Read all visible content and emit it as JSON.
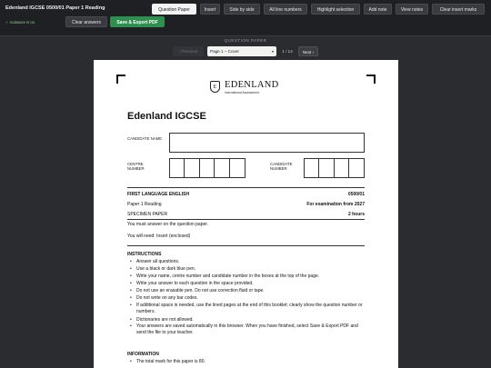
{
  "app": {
    "title": "Edenland IGCSE 0500/01 Paper 1 Reading",
    "autosave": "✓ Autosave is on"
  },
  "toolbar": {
    "question_paper": "Question Paper",
    "insert": "Insert",
    "side_by_side": "Side by side",
    "line_numbers": "All line numbers",
    "highlight": "Highlight selection",
    "add_note": "Add note",
    "view_notes": "View notes",
    "clear_marks": "Clear insert marks",
    "clear_answers": "Clear answers",
    "save_export": "Save & Export PDF"
  },
  "pager": {
    "section_label": "QUESTION PAPER",
    "prev": "‹ Previous",
    "selected": "Page 1 – Cover",
    "count": "1 / 14",
    "next": "Next ›"
  },
  "paper": {
    "logo_mark": "E",
    "logo_name": "EDENLAND",
    "logo_sub": "International Assessment",
    "title": "Edenland IGCSE",
    "candidate_name_label": "CANDIDATE NAME",
    "centre_number_label": "CENTRE NUMBER",
    "candidate_number_label": "CANDIDATE NUMBER",
    "subject": "FIRST LANGUAGE ENGLISH",
    "code": "0500/01",
    "paper_name": "Paper 1 Reading",
    "exam_from": "For examination from 2027",
    "specimen": "SPECIMEN PAPER",
    "duration": "2 hours",
    "answer_on": "You must answer on the question paper.",
    "you_will_need": "You will need:   Insert (enclosed)",
    "instructions_heading": "INSTRUCTIONS",
    "instructions": [
      "Answer all questions.",
      "Use a black or dark blue pen.",
      "Write your name, centre number and candidate number in the boxes at the top of the page.",
      "Write your answer to each question in the space provided.",
      "Do not use an erasable pen. Do not use correction fluid or tape.",
      "Do not write on any bar codes.",
      "If additional space is needed, use the lined pages at the end of this booklet; clearly show the question number or numbers.",
      "Dictionaries are not allowed.",
      "Your answers are saved automatically in this browser. When you have finished, select Save & Export PDF and send the file to your teacher."
    ],
    "information_heading": "INFORMATION",
    "information": [
      "The total mark for this paper is 80."
    ]
  }
}
